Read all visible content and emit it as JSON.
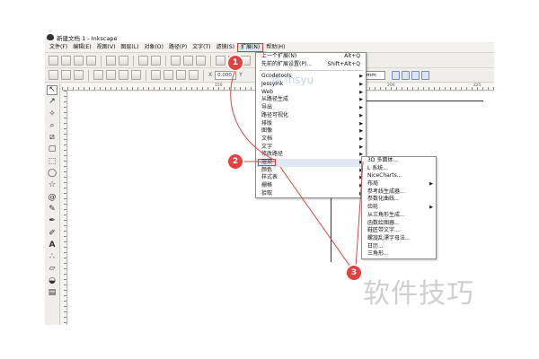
{
  "window": {
    "title": "新建文档 1 - Inkscape"
  },
  "menubar": {
    "items": [
      "文件(F)",
      "编辑(E)",
      "视图(V)",
      "图层(L)",
      "对象(O)",
      "路径(P)",
      "文字(T)",
      "滤镜(S)",
      "扩展(N)",
      "帮助(H)"
    ],
    "active": "扩展(N)"
  },
  "toolbar": {
    "x_label": "X",
    "x_value": "0.000",
    "y_label": "Y",
    "unit": "mm"
  },
  "ruler": {
    "ticks": [
      "150",
      "175",
      "200",
      "225"
    ]
  },
  "extensions_menu": {
    "items": [
      {
        "label": "上一个扩展(N)",
        "shortcut": "Alt+Q",
        "submenu": false
      },
      {
        "label": "先前的扩展设置(P)...",
        "shortcut": "Shift+Alt+Q",
        "submenu": false
      },
      {
        "separator": true
      },
      {
        "label": "Gcodetools",
        "submenu": true
      },
      {
        "label": "JessyInk",
        "submenu": true
      },
      {
        "label": "Web",
        "submenu": true
      },
      {
        "label": "从路径生成",
        "submenu": true
      },
      {
        "label": "导出",
        "submenu": true
      },
      {
        "label": "路径可视化",
        "submenu": true
      },
      {
        "label": "排版",
        "submenu": true
      },
      {
        "label": "图像",
        "submenu": true
      },
      {
        "label": "文档",
        "submenu": true
      },
      {
        "label": "文字",
        "submenu": true
      },
      {
        "label": "修改路径",
        "submenu": true
      },
      {
        "label": "渲染",
        "submenu": true,
        "highlighted": true
      },
      {
        "label": "颜色",
        "submenu": true
      },
      {
        "label": "样式表",
        "submenu": true
      },
      {
        "label": "栅格",
        "submenu": true
      },
      {
        "label": "拾取",
        "submenu": true
      }
    ]
  },
  "render_menu": {
    "items": [
      {
        "label": "3D 多面体...",
        "submenu": false
      },
      {
        "label": "L 系统...",
        "submenu": false
      },
      {
        "label": "NiceCharts...",
        "submenu": false
      },
      {
        "label": "布局",
        "submenu": true
      },
      {
        "label": "参考线生成器...",
        "submenu": false
      },
      {
        "label": "参数化曲线...",
        "submenu": false
      },
      {
        "label": "齿轮",
        "submenu": true
      },
      {
        "label": "从三角形生成...",
        "submenu": false
      },
      {
        "label": "函数绘图器...",
        "submenu": false
      },
      {
        "label": "鞋匠带文字...",
        "submenu": false
      },
      {
        "label": "螺旋乱漂字母法...",
        "submenu": false
      },
      {
        "label": "日历...",
        "submenu": false
      },
      {
        "label": "三角形...",
        "submenu": false
      }
    ]
  },
  "annotations": {
    "badge1": "1",
    "badge2": "2",
    "badge3": "3"
  },
  "watermark": {
    "site": "...谈 insyu",
    "text": "软件技巧"
  },
  "colors": {
    "annotation_red": "#e44141",
    "menu_highlight": "#dfe7f5"
  }
}
